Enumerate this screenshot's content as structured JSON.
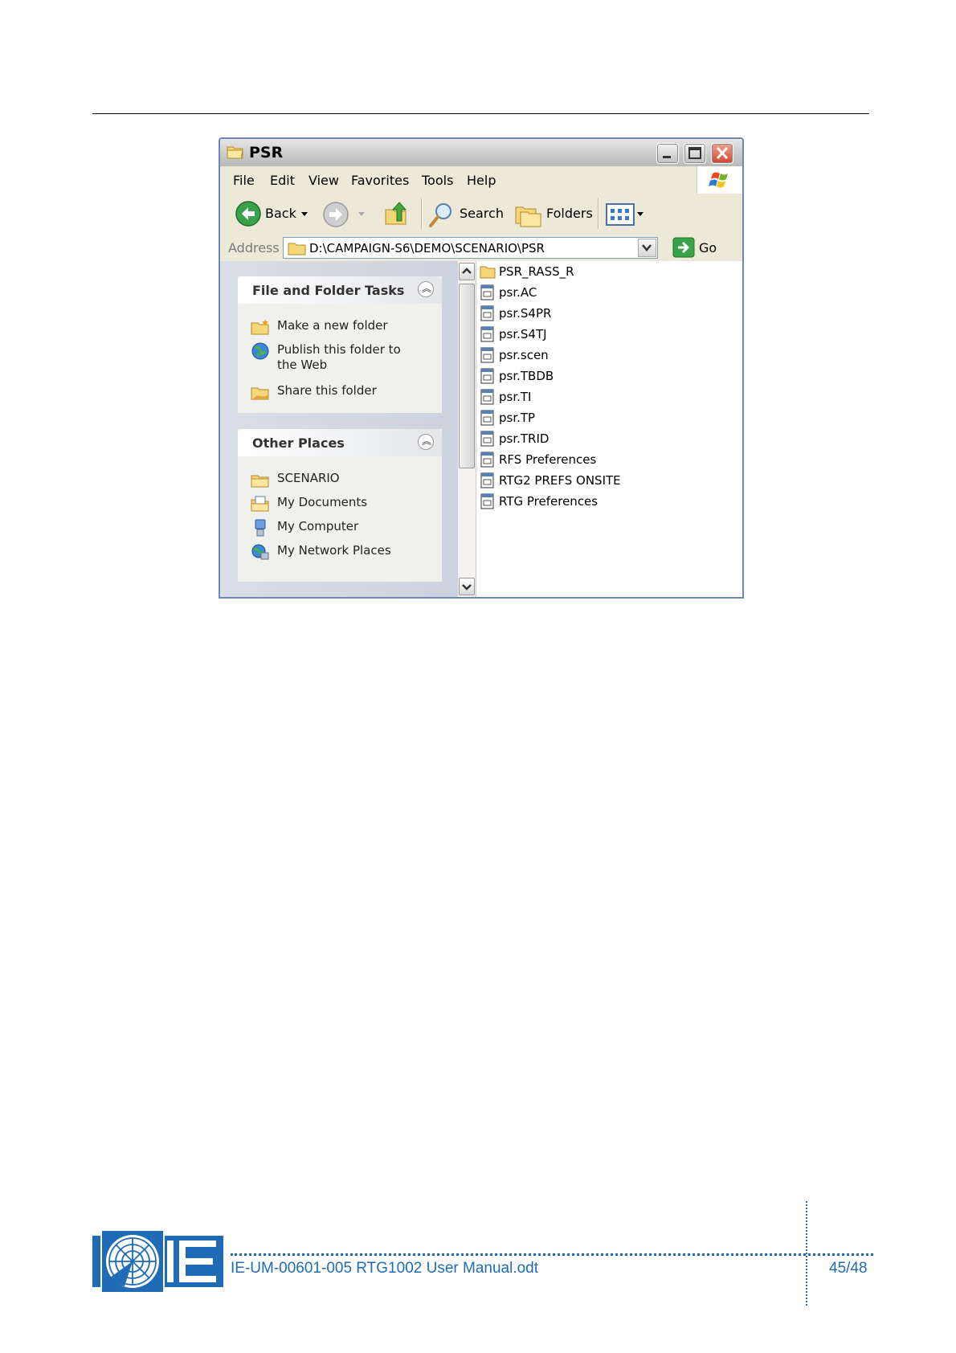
{
  "window": {
    "title": "PSR",
    "menu": [
      "File",
      "Edit",
      "View",
      "Favorites",
      "Tools",
      "Help"
    ],
    "toolbar": {
      "back": "Back",
      "search": "Search",
      "folders": "Folders"
    },
    "address": {
      "label": "Address",
      "value": "D:\\CAMPAIGN-S6\\DEMO\\SCENARIO\\PSR",
      "go": "Go"
    }
  },
  "task_pane": {
    "file_folder_tasks": {
      "title": "File and Folder Tasks",
      "items": [
        "Make a new folder",
        "Publish this folder to",
        "the Web",
        "Share this folder"
      ]
    },
    "other_places": {
      "title": "Other Places",
      "items": [
        "SCENARIO",
        "My Documents",
        "My Computer",
        "My Network Places"
      ]
    }
  },
  "files": [
    "PSR_RASS_R",
    "psr.AC",
    "psr.S4PR",
    "psr.S4TJ",
    "psr.scen",
    "psr.TBDB",
    "psr.TI",
    "psr.TP",
    "psr.TRID",
    "RFS Preferences",
    "RTG2 PREFS ONSITE",
    "RTG Preferences"
  ],
  "footer": {
    "document": "IE-UM-00601-005 RTG1002 User Manual.odt",
    "page": "45/48"
  },
  "colors": {
    "footer_blue": "#1f6bb5",
    "title_grey": "#c9c9c9"
  }
}
